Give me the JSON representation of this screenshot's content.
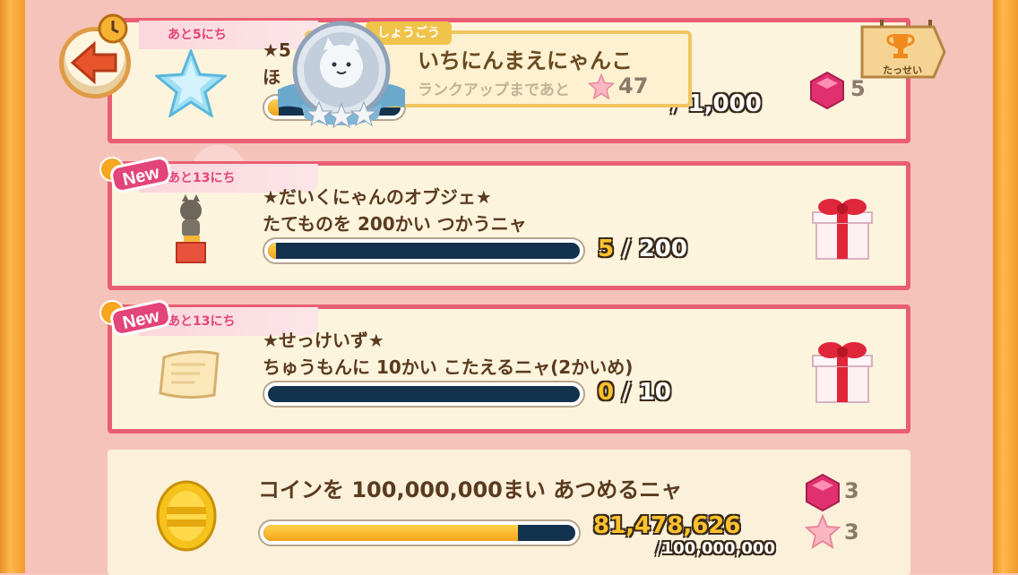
{
  "popup": {
    "tag": "しょうごう",
    "title": "いちにんまえにゃんこ",
    "subtitle": "ランクアップまであと",
    "count": "47"
  },
  "achievement_button": {
    "label": "たっせい"
  },
  "missions": [
    {
      "days": "あと5にち",
      "title_line1": "★5",
      "title_line2": "ほ",
      "progress_tail": "/ 1,000",
      "reward_count": "5"
    },
    {
      "days": "あと13にち",
      "badge": "New",
      "title_line1": "★だいくにゃんのオブジェ★",
      "title_line2": "たてものを 200かい つかうニャ",
      "current": "5",
      "total": "/ 200",
      "progress": 0.025
    },
    {
      "days": "あと13にち",
      "badge": "New",
      "title_line1": "★せっけいず★",
      "title_line2": "ちゅうもんに 10かい こたえるニャ(2かいめ)",
      "current": "0",
      "total": "/ 10",
      "progress": 0.0
    },
    {
      "title_line1": "コインを 100,000,000まい あつめるニャ",
      "current": "81,478,626",
      "total": "/100,000,000",
      "progress": 0.8148,
      "reward_gem": "3",
      "reward_star": "3"
    }
  ],
  "colors": {
    "accent": "#ea5e73",
    "frame": "#f39a2f",
    "bar_dark": "#13324e",
    "bar_fill": "#f5a219"
  }
}
